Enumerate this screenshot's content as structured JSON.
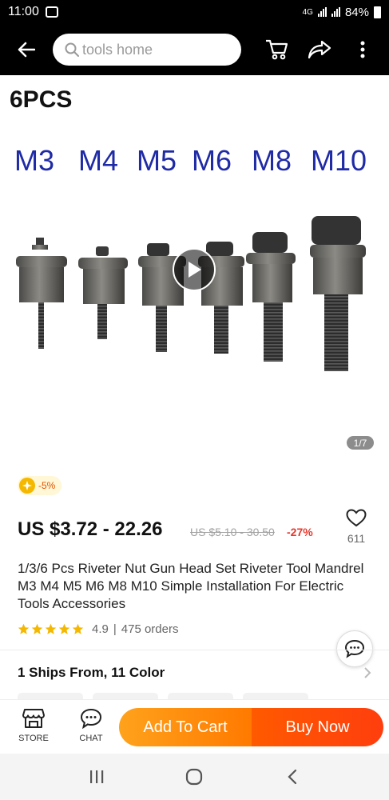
{
  "status_bar": {
    "time": "11:00",
    "network": "4G",
    "battery": "84%"
  },
  "top_nav": {
    "search_placeholder": "tools home",
    "icons": [
      "back-arrow-icon",
      "search-icon",
      "cart-icon",
      "share-icon",
      "more-icon"
    ]
  },
  "gallery": {
    "title": "6PCS",
    "sizes": [
      "M3",
      "M4",
      "M5",
      "M6",
      "M8",
      "M10"
    ],
    "indicator": "1/7",
    "play_icon": "play-icon"
  },
  "product": {
    "discount_badge": "-5%",
    "price": "US $3.72 - 22.26",
    "original_price": "US $5.10 - 30.50",
    "off": "-27%",
    "wishlist_count": "611",
    "title": "1/3/6 Pcs Riveter Nut Gun Head Set Riveter Tool Mandrel M3 M4 M5 M6 M8 M10 Simple Installation For Electric Tools Accessories",
    "rating": "4.9",
    "rating_stars": 5,
    "orders": "475 orders",
    "ships_from": "1 Ships From, 11 Color"
  },
  "action_bar": {
    "store_label": "STORE",
    "chat_label": "CHAT",
    "add_to_cart": "Add To Cart",
    "buy_now": "Buy Now"
  },
  "colors": {
    "accent_orange": "#ff7a00",
    "buy_red": "#ff3e0e",
    "size_label_blue": "#1f2aa6",
    "discount_red": "#e7372c"
  }
}
